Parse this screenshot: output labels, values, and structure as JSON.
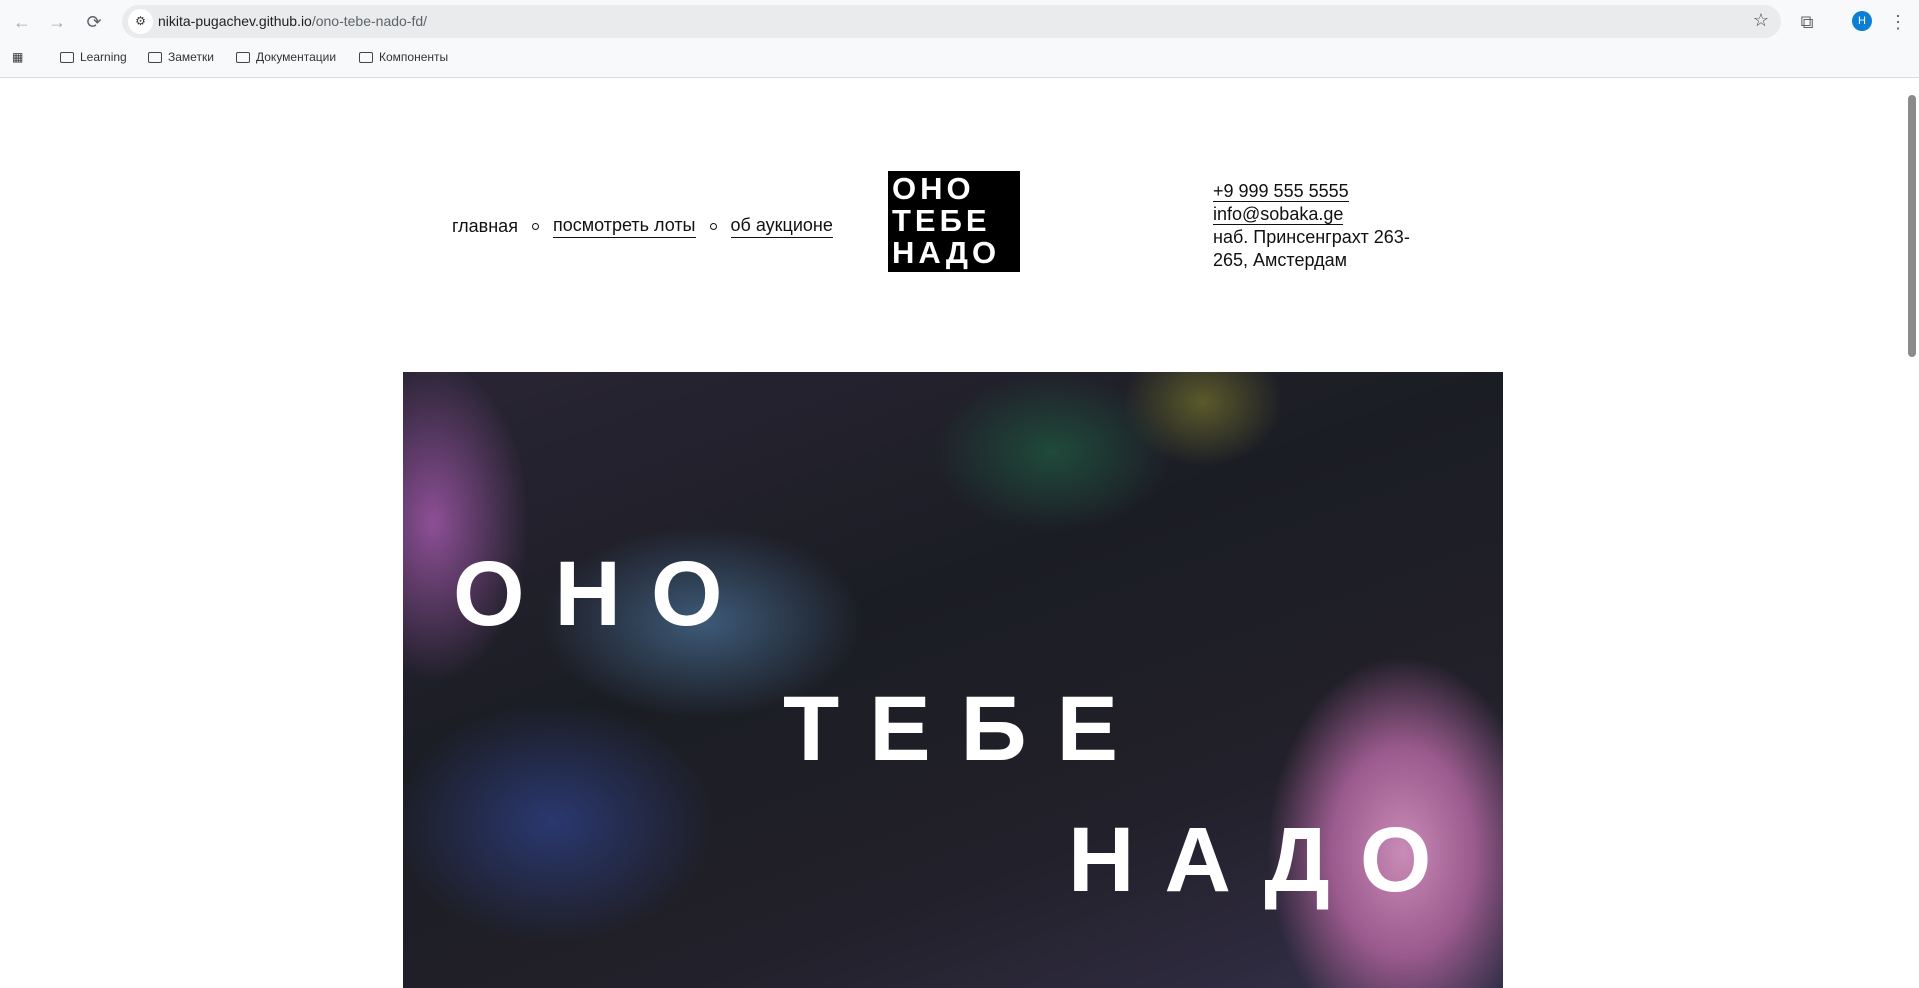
{
  "browser": {
    "url_host": "nikita-pugachev.github.io",
    "url_path": "/ono-tebe-nado-fd/",
    "avatar_letter": "H",
    "bookmarks": [
      "Learning",
      "Заметки",
      "Документации",
      "Компоненты"
    ]
  },
  "header": {
    "nav": [
      {
        "label": "главная"
      },
      {
        "label": "посмотреть лоты"
      },
      {
        "label": "об аукционе"
      }
    ],
    "logo_lines": [
      "ОНО",
      "ТЕБЕ",
      "НАДО"
    ],
    "phone": "+9 999 555 5555",
    "email": "info@sobaka.ge",
    "address": "наб. Принсенграхт 263-265, Амстердам"
  },
  "hero": {
    "line1": "ОНО",
    "line2": "ТЕБЕ",
    "line3": "НАДО"
  }
}
